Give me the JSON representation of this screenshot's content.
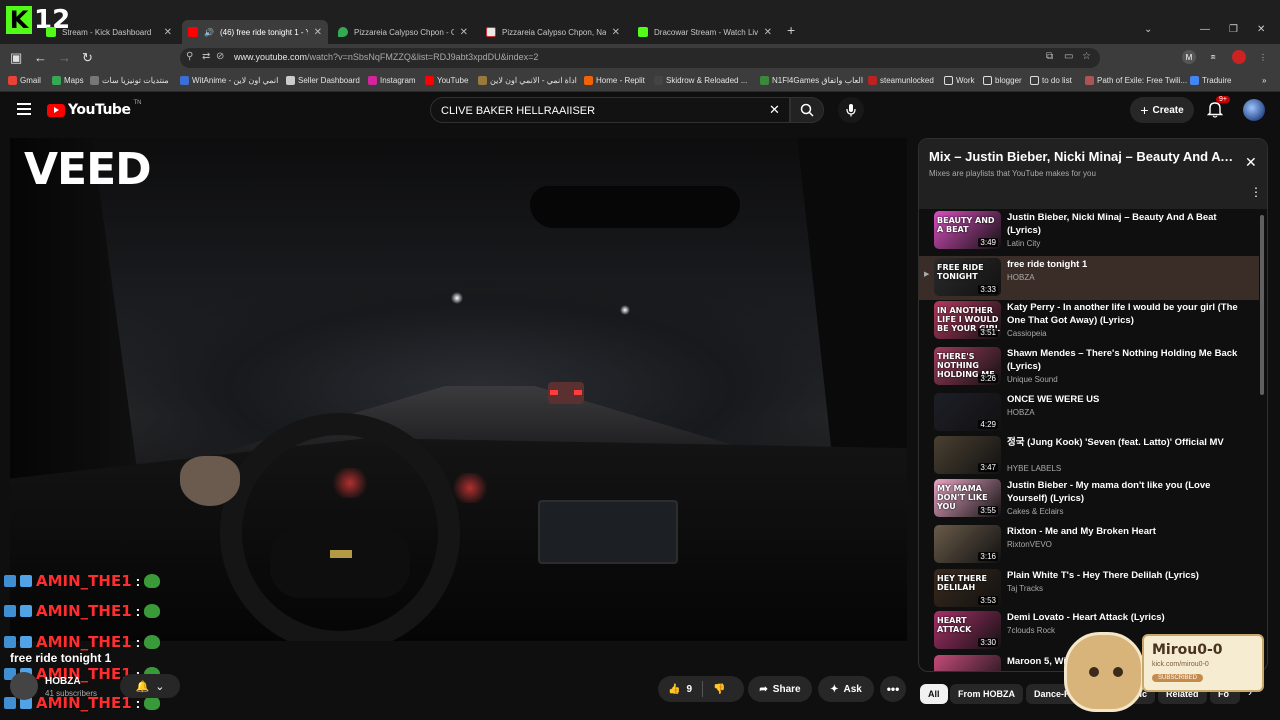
{
  "browser": {
    "tabs": [
      {
        "label": "Stream - Kick Dashboard",
        "color": "#53fc18"
      },
      {
        "label": "(46) free ride tonight 1 - YouTube",
        "color": "#ff0000"
      },
      {
        "label": "Pizzareia Calypso Chpon - Google",
        "color": "#34a853"
      },
      {
        "label": "Pizzareia Calypso Chpon, Nabeul",
        "color": "#e8e8e8"
      },
      {
        "label": "Dracowar Stream - Watch Live on Kick",
        "color": "#53fc18"
      }
    ],
    "url_host": "www.youtube.com",
    "url_path": "/watch?v=nSbsNqFMZZQ&list=RDJ9abt3xpdDU&index=2",
    "bookmarks": [
      "Gmail",
      "Maps",
      "منتديات تونيزيا سات",
      "WitAnime - انمي اون لاين",
      "Seller Dashboard",
      "Instagram",
      "YouTube",
      "اداة انمي - الانمي اون لاين",
      "Home - Replit",
      "Skidrow & Reloaded ...",
      "N1Fl4Games العاب واتفاق",
      "steamunlocked",
      "Work",
      "blogger",
      "to do list",
      "Path of Exile: Free Twili...",
      "Traduire"
    ]
  },
  "overlay_logo": {
    "letter": "K",
    "number": "12"
  },
  "youtube": {
    "logo_text": "YouTube",
    "logo_tm": "TN",
    "search_value": "CLIVE BAKER HELLRAAIISER",
    "create_label": "Create",
    "notif_count": "9+"
  },
  "video": {
    "watermark": "VEED",
    "title": "free ride tonight 1",
    "channel": "HOBZA",
    "subscribers": "41 subscribers",
    "likes": "9",
    "share_label": "Share",
    "ask_label": "Ask"
  },
  "chat": {
    "user": "AMIN_THE1",
    "separator": ":"
  },
  "playlist": {
    "title": "Mix – Justin Bieber, Nicki Minaj – Beauty And A Beat",
    "subtitle": "Mixes are playlists that YouTube makes for you",
    "items": [
      {
        "title": "Justin Bieber, Nicki Minaj – Beauty And A Beat (Lyrics)",
        "channel": "Latin City",
        "duration": "3:49",
        "thumb_text": "BEAUTY AND A BEAT",
        "color": "#d94fbf"
      },
      {
        "title": "free ride tonight 1",
        "channel": "HOBZA",
        "duration": "3:33",
        "thumb_text": "FREE RIDE TONIGHT",
        "color": "#2b2b2b"
      },
      {
        "title": "Katy Perry - In another life I would be your girl (The One That Got Away) (Lyrics)",
        "channel": "Cassiopeia",
        "duration": "3:51",
        "thumb_text": "IN ANOTHER LIFE I WOULD BE YOUR GIRL",
        "color": "#b1395f"
      },
      {
        "title": "Shawn Mendes – There's Nothing Holding Me Back (Lyrics)",
        "channel": "Unique Sound",
        "duration": "3:26",
        "thumb_text": "THERE'S NOTHING HOLDING ME",
        "color": "#9e3b5e"
      },
      {
        "title": "ONCE WE WERE US",
        "channel": "HOBZA",
        "duration": "4:29",
        "thumb_text": "",
        "color": "#1e1e28"
      },
      {
        "title": "정국 (Jung Kook) 'Seven (feat. Latto)' Official MV",
        "channel": "HYBE LABELS",
        "duration": "3:47",
        "thumb_text": "",
        "color": "#4a4032"
      },
      {
        "title": "Justin Bieber - My mama don't like you (Love Yourself) (Lyrics)",
        "channel": "Cakes & Eclairs",
        "duration": "3:55",
        "thumb_text": "MY MAMA DON'T LIKE YOU",
        "color": "#e9a6c4"
      },
      {
        "title": "Rixton - Me and My Broken Heart",
        "channel": "RixtonVEVO",
        "duration": "3:16",
        "thumb_text": "",
        "color": "#6a5b4a"
      },
      {
        "title": "Plain White T's - Hey There Delilah (Lyrics)",
        "channel": "Taj Tracks",
        "duration": "3:53",
        "thumb_text": "HEY THERE DELILAH",
        "color": "#3a2a1e"
      },
      {
        "title": "Demi Lovato - Heart Attack (Lyrics)",
        "channel": "7clouds Rock",
        "duration": "3:30",
        "thumb_text": "HEART ATTACK",
        "color": "#a8306a"
      },
      {
        "title": "Maroon 5, Wiz",
        "channel": "",
        "duration": "",
        "thumb_text": "",
        "color": "#c54b7a"
      }
    ]
  },
  "chips": [
    "All",
    "From HOBZA",
    "Dance-Pop",
    "Pop Music",
    "Related",
    "Fo"
  ],
  "sticker": {
    "name": "Mirou0-0",
    "url": "kick.com/mirou0-0",
    "badge": "SUBSCRIBED"
  }
}
